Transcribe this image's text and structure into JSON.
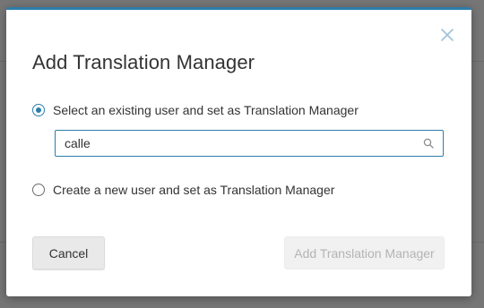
{
  "dialog": {
    "title": "Add Translation Manager",
    "close_icon": "close-icon",
    "accent_color": "#2d7dab",
    "options": [
      {
        "label": "Select an existing user and set as Translation Manager",
        "selected": true
      },
      {
        "label": "Create a new user and set as Translation Manager",
        "selected": false
      }
    ],
    "search": {
      "value": "calle",
      "placeholder": "",
      "icon": "search-icon"
    },
    "buttons": {
      "cancel_label": "Cancel",
      "submit_label": "Add Translation Manager",
      "submit_disabled": true
    }
  }
}
